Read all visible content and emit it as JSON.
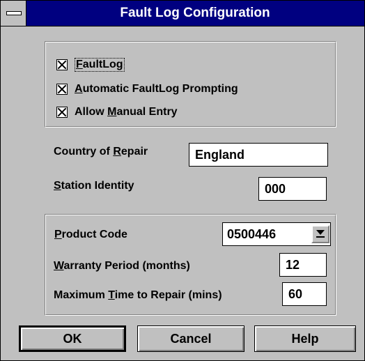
{
  "window": {
    "title": "Fault Log Configuration"
  },
  "options": {
    "faultlog": {
      "pre": "",
      "key": "F",
      "post": "aultLog",
      "checked": true
    },
    "auto_prompt": {
      "pre": "",
      "key": "A",
      "post": "utomatic FaultLog Prompting",
      "checked": true
    },
    "manual_entry": {
      "pre": "Allow ",
      "key": "M",
      "post": "anual Entry",
      "checked": true
    }
  },
  "location": {
    "country": {
      "pre": "Country of ",
      "key": "R",
      "post": "epair",
      "value": "England"
    },
    "station": {
      "pre": "",
      "key": "S",
      "post": "tation Identity",
      "value": "000"
    }
  },
  "product": {
    "code": {
      "pre": "",
      "key": "P",
      "post": "roduct Code",
      "value": "0500446"
    },
    "warranty": {
      "pre": "",
      "key": "W",
      "post": "arranty Period (months)",
      "value": "12"
    },
    "max_time": {
      "pre": "Maximum ",
      "key": "T",
      "post": "ime to Repair (mins)",
      "value": "60"
    }
  },
  "buttons": {
    "ok": "OK",
    "cancel": "Cancel",
    "help": "Help"
  }
}
